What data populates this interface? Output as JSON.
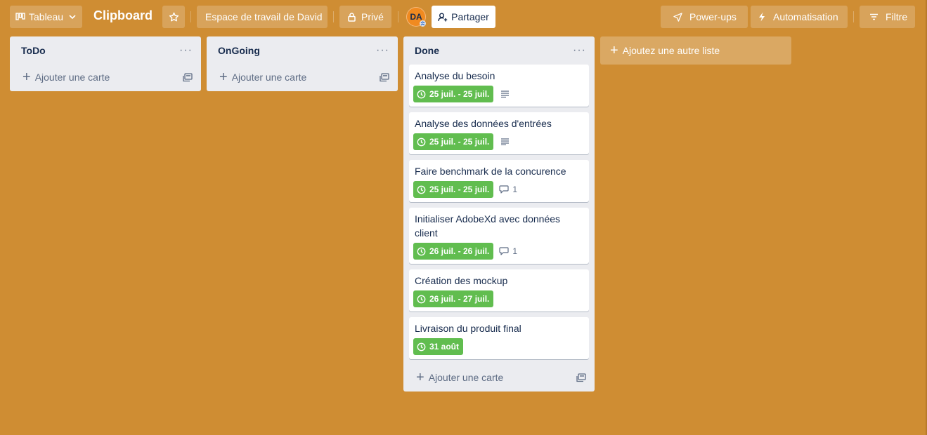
{
  "topbar": {
    "view_label": "Tableau",
    "board_title": "Clipboard",
    "workspace_label": "Espace de travail de David",
    "visibility_label": "Privé",
    "avatar_initials": "DA",
    "share_label": "Partager",
    "powerups_label": "Power-ups",
    "automation_label": "Automatisation",
    "filter_label": "Filtre"
  },
  "colors": {
    "board_bg": "#cf8d33",
    "list_bg": "#ebecf0",
    "due_green": "#61bd4f"
  },
  "lists": [
    {
      "title": "ToDo",
      "add_card_label": "Ajouter une carte",
      "cards": []
    },
    {
      "title": "OnGoing",
      "add_card_label": "Ajouter une carte",
      "cards": []
    },
    {
      "title": "Done",
      "add_card_label": "Ajouter une carte",
      "cards": [
        {
          "title": "Analyse du besoin",
          "due": "25 juil. - 25 juil.",
          "has_description": true
        },
        {
          "title": "Analyse des données d'entrées",
          "due": "25 juil. - 25 juil.",
          "has_description": true
        },
        {
          "title": "Faire benchmark de la concurence",
          "due": "25 juil. - 25 juil.",
          "comments": "1"
        },
        {
          "title": "Initialiser AdobeXd avec données client",
          "due": "26 juil. - 26 juil.",
          "comments": "1"
        },
        {
          "title": "Création des mockup",
          "due": "26 juil. - 27 juil."
        },
        {
          "title": "Livraison du produit final",
          "due": "31 août"
        }
      ]
    }
  ],
  "add_list_label": "Ajoutez une autre liste",
  "icons": {
    "board": "board-icon",
    "chevron": "chevron-down-icon",
    "star": "star-icon",
    "lock": "lock-icon",
    "share": "add-person-icon",
    "rocket": "rocket-icon",
    "bolt": "bolt-icon",
    "filter": "filter-icon",
    "clock": "clock-icon",
    "description": "description-icon",
    "comment": "comment-icon",
    "template": "card-template-icon",
    "menu": "more-icon"
  }
}
